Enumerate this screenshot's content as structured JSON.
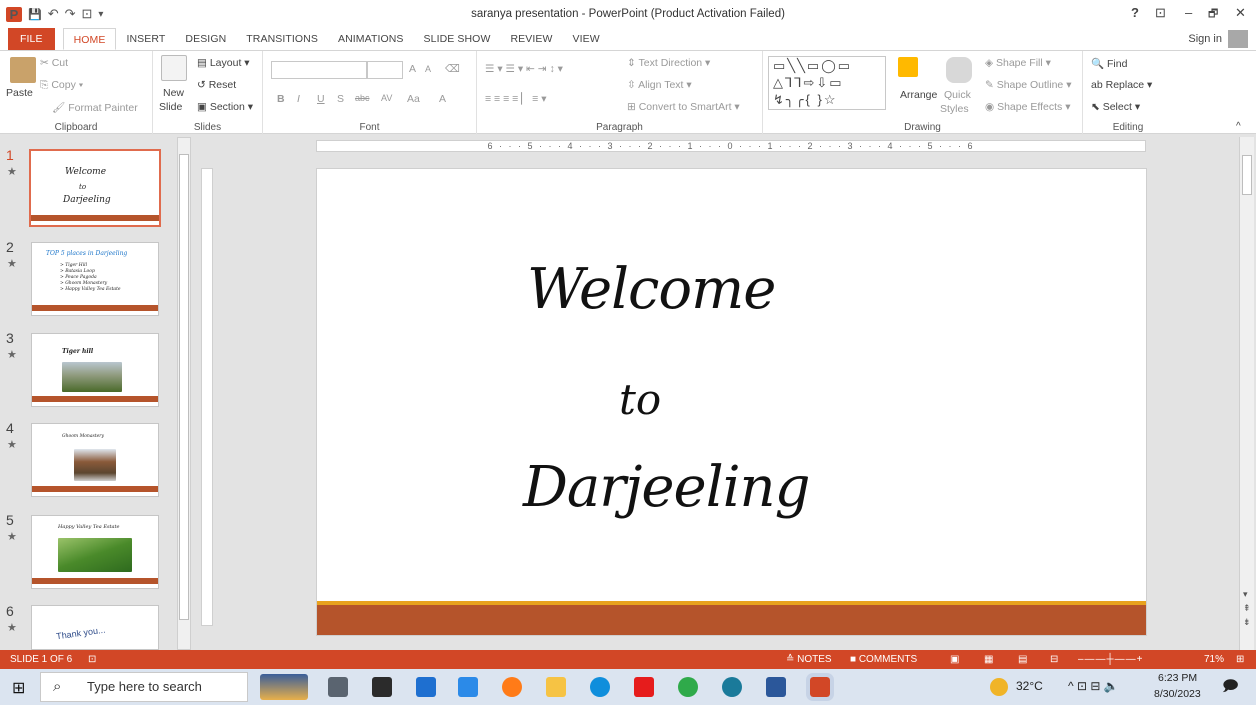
{
  "window": {
    "title": "saranya presentation - PowerPoint (Product Activation Failed)",
    "help": "?",
    "restore_ribbon": "⊡",
    "minimize": "–",
    "restore": "🗗",
    "close": "✕"
  },
  "quick_access": {
    "logo": "P",
    "save": "💾",
    "undo": "↶",
    "redo": "↷",
    "from_beginning": "⊡",
    "customize": "▾"
  },
  "tabs": [
    "FILE",
    "HOME",
    "INSERT",
    "DESIGN",
    "TRANSITIONS",
    "ANIMATIONS",
    "SLIDE SHOW",
    "REVIEW",
    "VIEW"
  ],
  "active_tab": "HOME",
  "sign_in": "Sign in",
  "ribbon": {
    "clipboard": {
      "label": "Clipboard",
      "paste": "Paste",
      "cut": "Cut",
      "copy": "Copy",
      "format_painter": "Format Painter"
    },
    "slides": {
      "label": "Slides",
      "new_slide": "New",
      "new_slide2": "Slide",
      "layout": "Layout",
      "reset": "Reset",
      "section": "Section"
    },
    "font": {
      "label": "Font",
      "bold": "B",
      "italic": "I",
      "underline": "U",
      "shadow": "S",
      "strike": "abc",
      "spacing": "AV",
      "case": "Aa",
      "color": "A",
      "grow": "A",
      "shrink": "A"
    },
    "paragraph": {
      "label": "Paragraph",
      "text_direction": "Text Direction",
      "align_text": "Align Text",
      "convert_smartart": "Convert to SmartArt"
    },
    "drawing": {
      "label": "Drawing",
      "arrange": "Arrange",
      "quick_styles": "Quick",
      "quick_styles2": "Styles",
      "shape_fill": "Shape Fill",
      "shape_outline": "Shape Outline",
      "shape_effects": "Shape Effects",
      "shapes_row1": "▭╲╲▭◯▭",
      "shapes_row2": "△⅂⅂⇨⇩▭",
      "shapes_row3": "↯╮╭{ }☆"
    },
    "editing": {
      "label": "Editing",
      "find": "Find",
      "replace": "Replace",
      "select": "Select"
    }
  },
  "thumbnails": [
    {
      "num": "1",
      "lines": [
        "Welcome",
        "to",
        "Darjeeling"
      ]
    },
    {
      "num": "2",
      "title": "TOP 5 places in Darjeeling",
      "bullets": [
        "> Tiger Hill",
        "> Batasia Loop",
        "> Peace Pagoda",
        "> Ghoom Monastery",
        "> Happy Valley Tea Estate"
      ]
    },
    {
      "num": "3",
      "title": "Tiger hill"
    },
    {
      "num": "4",
      "title": "Ghoom Monastery"
    },
    {
      "num": "5",
      "title": "Happy Valley Tea Estate"
    },
    {
      "num": "6",
      "title": "Thank you..."
    }
  ],
  "ruler_text": "6 · · · 5 · · · 4 · · · 3 · · · 2 · · · 1 · · · 0 · · · 1 · · · 2 · · · 3 · · · 4 · · · 5 · · · 6",
  "slide": {
    "line1": "Welcome",
    "line2": "to",
    "line3": "Darjeeling"
  },
  "status": {
    "slide": "SLIDE 1 OF 6",
    "notes": "≙ NOTES",
    "comments": "COMMENTS",
    "zoom": "71%"
  },
  "taskbar": {
    "search_placeholder": "Type here to search",
    "temp": "32°C",
    "time": "6:23 PM",
    "date": "8/30/2023"
  },
  "colors": {
    "accent": "#d24726",
    "slide_band": "#b5542b",
    "slide_stripe": "#e8a21e"
  }
}
